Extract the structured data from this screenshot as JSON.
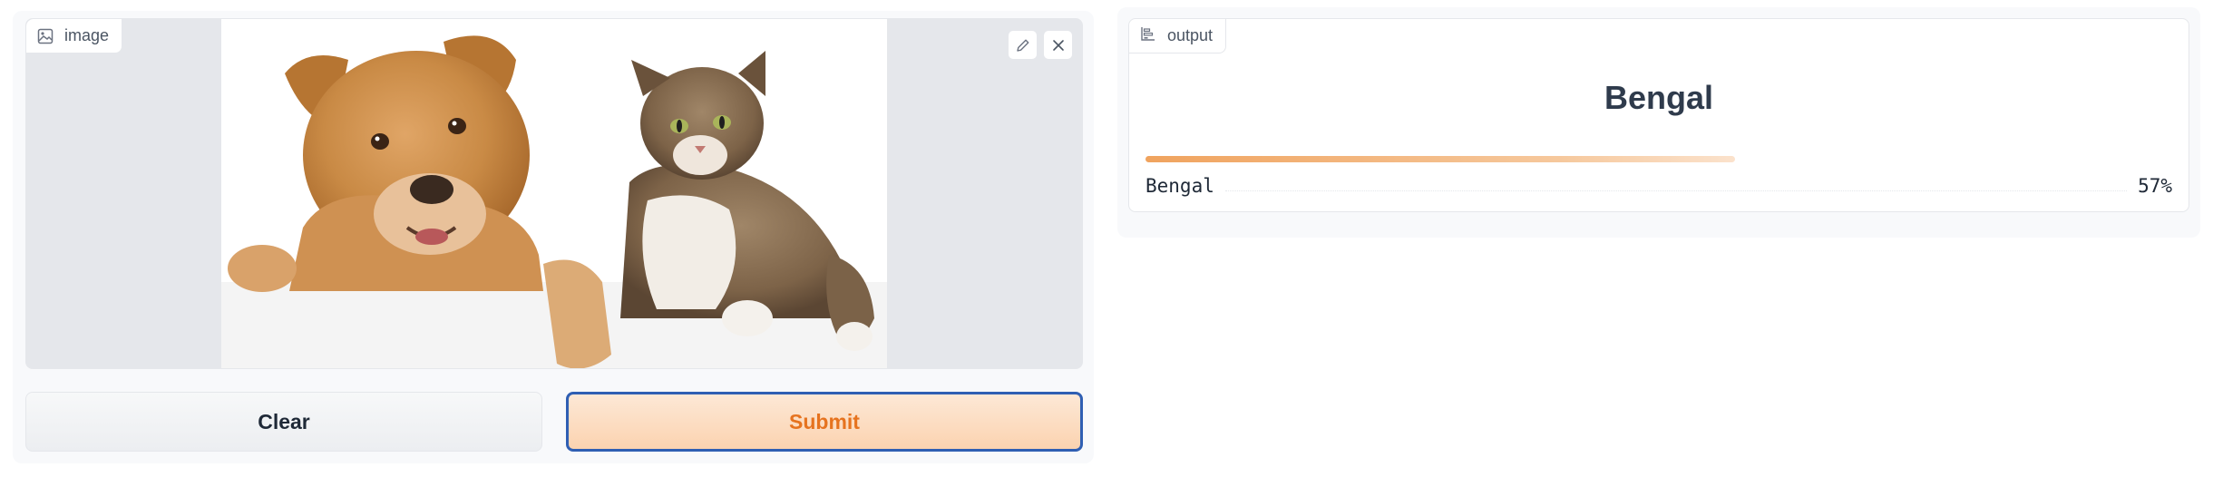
{
  "input": {
    "label": "image",
    "label_icon": "image-icon",
    "edit_icon": "pencil-icon",
    "close_icon": "close-icon"
  },
  "buttons": {
    "clear_label": "Clear",
    "submit_label": "Submit"
  },
  "output": {
    "label": "output",
    "label_icon": "bar-chart-icon",
    "top_label": "Bengal",
    "results": [
      {
        "label": "Bengal",
        "confidence_text": "57%",
        "confidence": 0.57
      }
    ]
  },
  "colors": {
    "accent": "#e6731f",
    "submit_border": "#2f5fb3",
    "bar_start": "#f0a35e"
  }
}
